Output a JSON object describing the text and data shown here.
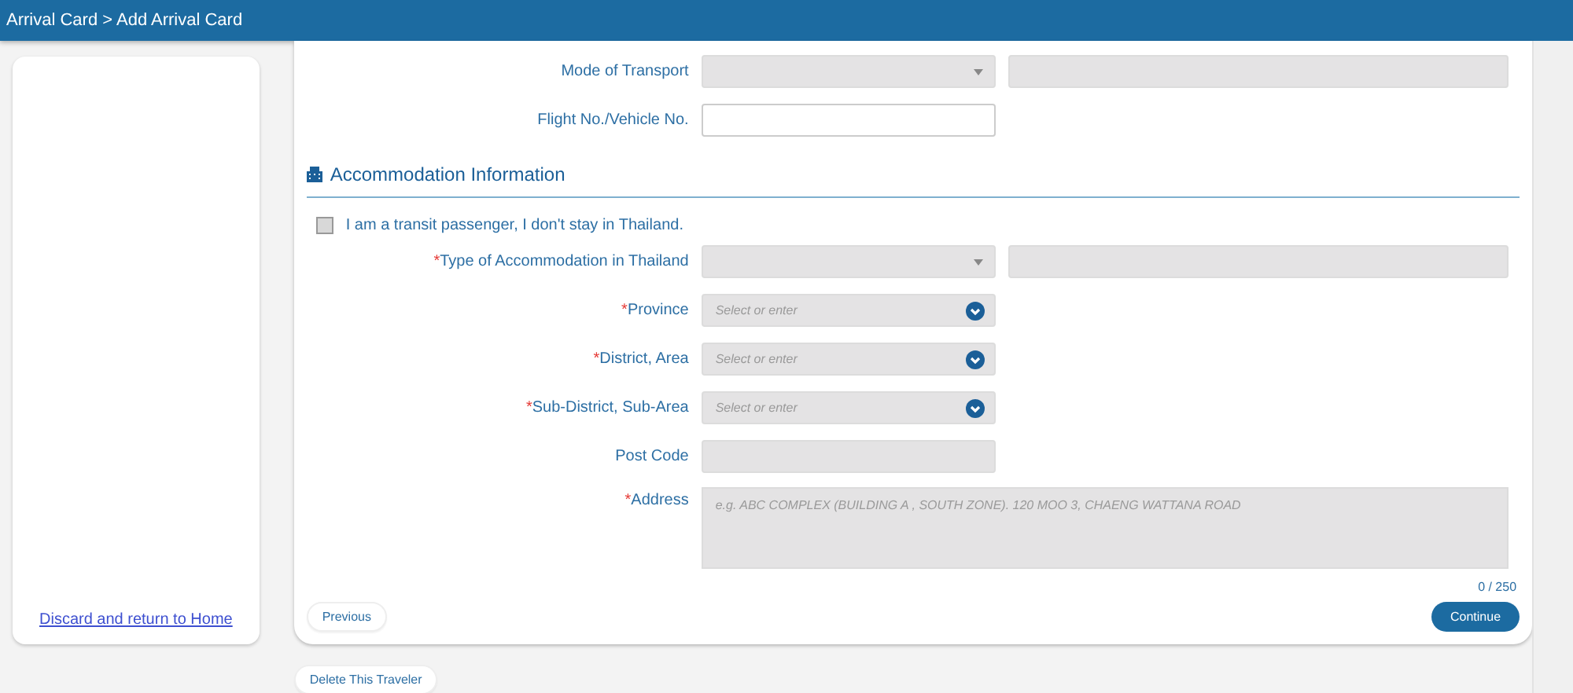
{
  "header": {
    "breadcrumb": "Arrival Card > Add Arrival Card"
  },
  "sidebar": {
    "link": "Discard and return to Home"
  },
  "transport_fields": [
    {
      "label": "Mode of Transport",
      "kind": "dropdown",
      "extra_field": true
    },
    {
      "label": "Flight No./Vehicle No.",
      "kind": "text",
      "extra_field": false
    }
  ],
  "section": {
    "title": "Accommodation Information"
  },
  "transit_checkbox": {
    "label": "I am a transit passenger, I don't stay in Thailand.",
    "checked": false
  },
  "accommodation_fields": [
    {
      "label": "Type of Accommodation in Thailand",
      "required_mark": "*",
      "kind": "dropdown",
      "extra_field": true
    },
    {
      "label": "Province",
      "required_mark": "*",
      "kind": "combo",
      "placeholder": "Select or enter",
      "extra_field": false
    },
    {
      "label": "District, Area",
      "required_mark": "*",
      "kind": "combo",
      "placeholder": "Select or enter",
      "extra_field": false
    },
    {
      "label": "Sub-District, Sub-Area",
      "required_mark": "*",
      "kind": "combo",
      "placeholder": "Select or enter",
      "extra_field": false
    },
    {
      "label": "Post Code",
      "kind": "readonly",
      "extra_field": false
    },
    {
      "label": "Address",
      "required_mark": "*",
      "kind": "textarea",
      "placeholder": "e.g. ABC COMPLEX (BUILDING A , SOUTH ZONE). 120 MOO 3, CHAENG WATTANA ROAD",
      "extra_field": false
    }
  ],
  "char_counter": "0 / 250",
  "buttons": {
    "previous": "Previous",
    "continue": "Continue",
    "delete": "Delete This Traveler"
  }
}
